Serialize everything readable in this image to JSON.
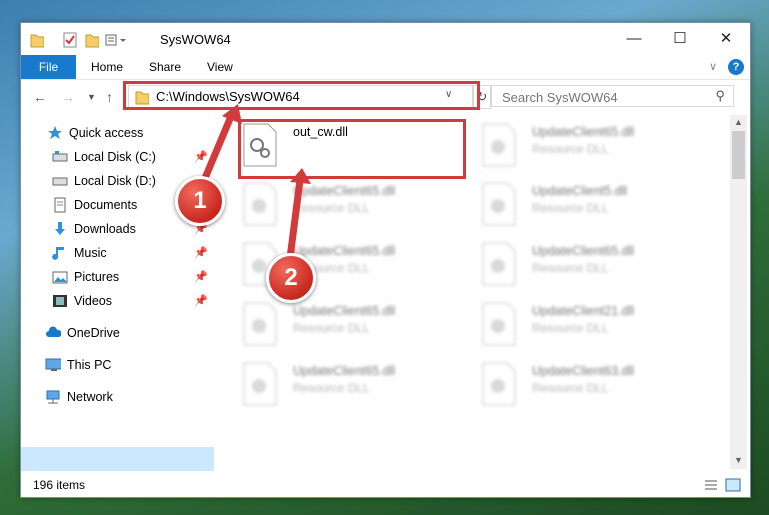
{
  "window": {
    "title": "SysWOW64"
  },
  "ribbon": {
    "tabs": [
      "File",
      "Home",
      "Share",
      "View"
    ]
  },
  "nav": {
    "address": "C:\\Windows\\SysWOW64",
    "search_placeholder": "Search SysWOW64"
  },
  "sidebar": {
    "items": [
      {
        "label": "Quick access",
        "icon": "star-icon"
      },
      {
        "label": "Local Disk (C:)",
        "icon": "drive-icon"
      },
      {
        "label": "Local Disk (D:)",
        "icon": "drive-icon"
      },
      {
        "label": "Documents",
        "icon": "documents-icon"
      },
      {
        "label": "Downloads",
        "icon": "download-icon"
      },
      {
        "label": "Music",
        "icon": "music-icon"
      },
      {
        "label": "Pictures",
        "icon": "pictures-icon"
      },
      {
        "label": "Videos",
        "icon": "videos-icon"
      },
      {
        "label": "OneDrive",
        "icon": "cloud-icon"
      },
      {
        "label": "This PC",
        "icon": "computer-icon"
      },
      {
        "label": "Network",
        "icon": "network-icon"
      }
    ]
  },
  "files": {
    "selected": {
      "name": "out_cw.dll"
    },
    "others": [
      {
        "name": "UpdateClient65.dll",
        "type": "Resource DLL"
      },
      {
        "name": "UpdateClient65.dll",
        "type": "Resource DLL"
      },
      {
        "name": "UpdateClient5.dll",
        "type": "Resource DLL"
      },
      {
        "name": "UpdateClient65.dll",
        "type": "Resource DLL"
      },
      {
        "name": "UpdateClient65.dll",
        "type": "Resource DLL"
      },
      {
        "name": "UpdateClient65.dll",
        "type": "Resource DLL"
      },
      {
        "name": "UpdateClient21.dll",
        "type": "Resource DLL"
      },
      {
        "name": "UpdateClient65.dll",
        "type": "Resource DLL"
      },
      {
        "name": "UpdateClient63.dll",
        "type": "Resource DLL"
      }
    ]
  },
  "status": {
    "count": "196 items"
  },
  "annotations": {
    "step1": "1",
    "step2": "2",
    "color": "#d23b3b"
  }
}
